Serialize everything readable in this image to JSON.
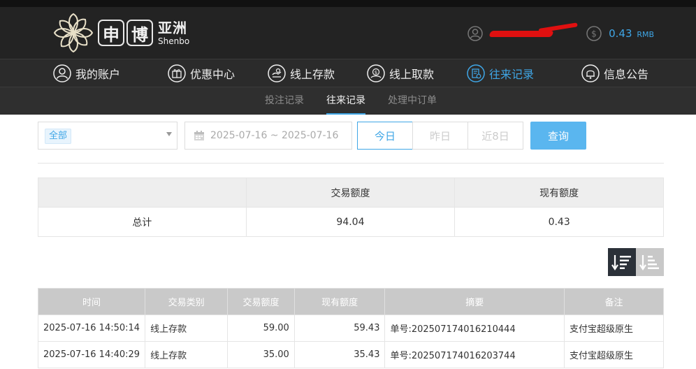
{
  "brand": {
    "box_chars": [
      "申",
      "博"
    ],
    "cn": "亚洲",
    "en": "Shenbo"
  },
  "account": {
    "balance": "0.43",
    "currency": "RMB"
  },
  "nav": [
    {
      "label": "我的账户",
      "icon": "user-icon"
    },
    {
      "label": "优惠中心",
      "icon": "gift-icon"
    },
    {
      "label": "线上存款",
      "icon": "deposit-icon"
    },
    {
      "label": "线上取款",
      "icon": "withdraw-icon"
    },
    {
      "label": "往来记录",
      "icon": "records-icon",
      "active": true
    },
    {
      "label": "信息公告",
      "icon": "bell-icon"
    }
  ],
  "subnav": [
    {
      "label": "投注记录"
    },
    {
      "label": "往来记录",
      "active": true
    },
    {
      "label": "处理中订单"
    }
  ],
  "filters": {
    "type_selected": "全部",
    "date_range": "2025-07-16 ~ 2025-07-16",
    "quick_ranges": [
      "今日",
      "昨日",
      "近8日"
    ],
    "active_range": "今日",
    "query_label": "查询"
  },
  "summary": {
    "headers": [
      "",
      "交易额度",
      "现有额度"
    ],
    "row": {
      "label": "总计",
      "amount": "94.04",
      "balance": "0.43"
    }
  },
  "records": {
    "headers": [
      "时间",
      "交易类别",
      "交易额度",
      "现有额度",
      "摘要",
      "备注"
    ],
    "rows": [
      {
        "time": "2025-07-16 14:50:14",
        "type": "线上存款",
        "amount": "59.00",
        "balance": "59.43",
        "summary": "单号:202507174016210444",
        "note": "支付宝超级原生"
      },
      {
        "time": "2025-07-16 14:40:29",
        "type": "线上存款",
        "amount": "35.00",
        "balance": "35.43",
        "summary": "单号:202507174016203744",
        "note": "支付宝超级原生"
      }
    ]
  },
  "colors": {
    "accent": "#3fa6e6",
    "header_bg": "#232323",
    "nav_bg": "#2b2b2b",
    "redaction": "#e01010"
  }
}
